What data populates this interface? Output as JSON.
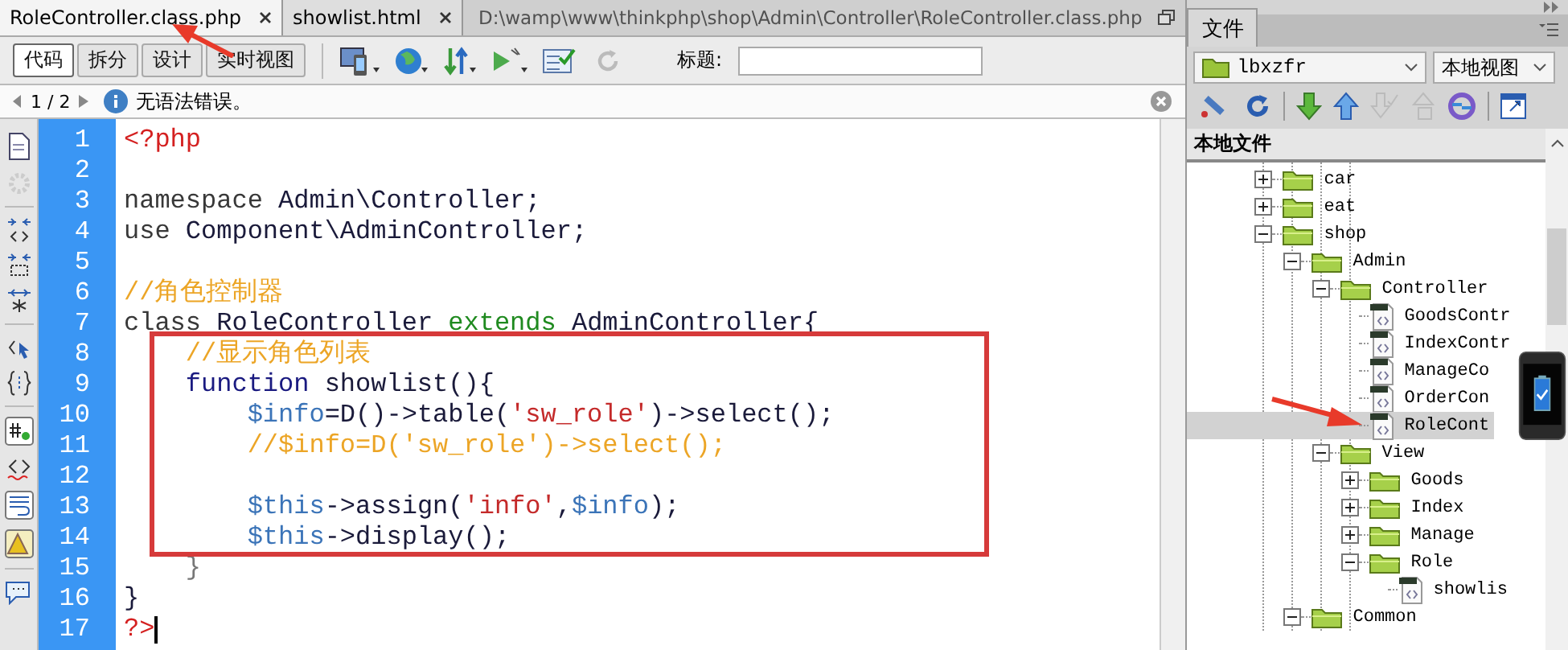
{
  "tabs": [
    {
      "label": "RoleController.class.php",
      "selected": true
    },
    {
      "label": "showlist.html",
      "selected": false
    }
  ],
  "file_path": "D:\\wamp\\www\\thinkphp\\shop\\Admin\\Controller\\RoleController.class.php",
  "view_buttons": [
    {
      "label": "代码",
      "selected": true
    },
    {
      "label": "拆分",
      "selected": false
    },
    {
      "label": "设计",
      "selected": false
    },
    {
      "label": "实时视图",
      "selected": false
    }
  ],
  "title_field": {
    "label": "标题:"
  },
  "status": {
    "page": "1 / 2",
    "message": "无语法错误。"
  },
  "code_lines": [
    {
      "number": "1",
      "tokens": [
        {
          "t": "<?php",
          "kind": "tag"
        }
      ]
    },
    {
      "number": "2"
    },
    {
      "number": "3",
      "tokens": [
        {
          "t": "namespace",
          "kind": "keyword"
        },
        {
          "t": " Admin\\Controller;",
          "kind": "plain"
        }
      ]
    },
    {
      "number": "4",
      "tokens": [
        {
          "t": "use",
          "kind": "keyword"
        },
        {
          "t": " Component\\AdminController;",
          "kind": "plain"
        }
      ]
    },
    {
      "number": "5"
    },
    {
      "number": "6",
      "tokens": [
        {
          "t": "//角色控制器",
          "kind": "comment"
        }
      ]
    },
    {
      "number": "7",
      "tokens": [
        {
          "t": "class",
          "kind": "keyword"
        },
        {
          "t": " RoleController ",
          "kind": "plain"
        },
        {
          "t": "extends",
          "kind": "extends"
        },
        {
          "t": " AdminController{",
          "kind": "plain"
        }
      ]
    },
    {
      "number": "8",
      "tokens": [
        {
          "t": "    //显示角色列表",
          "kind": "comment"
        }
      ]
    },
    {
      "number": "9",
      "tokens": [
        {
          "t": "    function",
          "kind": "function"
        },
        {
          "t": " showlist(){",
          "kind": "plain"
        }
      ]
    },
    {
      "number": "10",
      "tokens": [
        {
          "t": "        $info",
          "kind": "variable"
        },
        {
          "t": "=D()->table(",
          "kind": "plain"
        },
        {
          "t": "'sw_role'",
          "kind": "string"
        },
        {
          "t": ")->select();",
          "kind": "plain"
        }
      ]
    },
    {
      "number": "11",
      "tokens": [
        {
          "t": "        //$info=D('sw_role')->select();",
          "kind": "comment"
        }
      ]
    },
    {
      "number": "12"
    },
    {
      "number": "13",
      "tokens": [
        {
          "t": "        $this",
          "kind": "variable"
        },
        {
          "t": "->assign(",
          "kind": "plain"
        },
        {
          "t": "'info'",
          "kind": "string"
        },
        {
          "t": ",",
          "kind": "plain"
        },
        {
          "t": "$info",
          "kind": "variable"
        },
        {
          "t": ");",
          "kind": "plain"
        }
      ]
    },
    {
      "number": "14",
      "tokens": [
        {
          "t": "        $this",
          "kind": "variable"
        },
        {
          "t": "->display();",
          "kind": "plain"
        }
      ]
    },
    {
      "number": "15",
      "tokens": [
        {
          "t": "    }",
          "kind": "dim"
        }
      ]
    },
    {
      "number": "16",
      "tokens": [
        {
          "t": "}",
          "kind": "plain"
        }
      ]
    },
    {
      "number": "17",
      "tokens": [
        {
          "t": "?>",
          "kind": "tag"
        }
      ]
    }
  ],
  "files_panel": {
    "tab": "文件",
    "site": "lbxzfr",
    "view": "本地视图",
    "header": "本地文件",
    "tree": [
      {
        "label": "car",
        "kind": "folder",
        "expanded": false,
        "selected": false
      },
      {
        "label": "eat",
        "kind": "folder",
        "expanded": false,
        "selected": false
      },
      {
        "label": "shop",
        "kind": "folder",
        "expanded": true,
        "selected": false,
        "children": [
          {
            "label": "Admin",
            "kind": "folder",
            "expanded": true,
            "selected": false,
            "children": [
              {
                "label": "Controller",
                "kind": "folder",
                "expanded": true,
                "selected": false,
                "children": [
                  {
                    "label": "GoodsContr",
                    "kind": "file",
                    "selected": false
                  },
                  {
                    "label": "IndexContr",
                    "kind": "file",
                    "selected": false
                  },
                  {
                    "label": "ManageCo",
                    "kind": "file",
                    "selected": false
                  },
                  {
                    "label": "OrderCon",
                    "kind": "file",
                    "selected": false
                  },
                  {
                    "label": "RoleCont",
                    "kind": "file",
                    "selected": true
                  }
                ]
              },
              {
                "label": "View",
                "kind": "folder",
                "expanded": true,
                "selected": false,
                "children": [
                  {
                    "label": "Goods",
                    "kind": "folder",
                    "expanded": false,
                    "selected": false
                  },
                  {
                    "label": "Index",
                    "kind": "folder",
                    "expanded": false,
                    "selected": false
                  },
                  {
                    "label": "Manage",
                    "kind": "folder",
                    "expanded": false,
                    "selected": false
                  },
                  {
                    "label": "Role",
                    "kind": "folder",
                    "expanded": true,
                    "selected": false,
                    "children": [
                      {
                        "label": "showlis",
                        "kind": "file",
                        "selected": false
                      }
                    ]
                  }
                ]
              }
            ]
          },
          {
            "label": "Common",
            "kind": "folder",
            "expanded": true,
            "selected": false
          }
        ]
      }
    ]
  }
}
